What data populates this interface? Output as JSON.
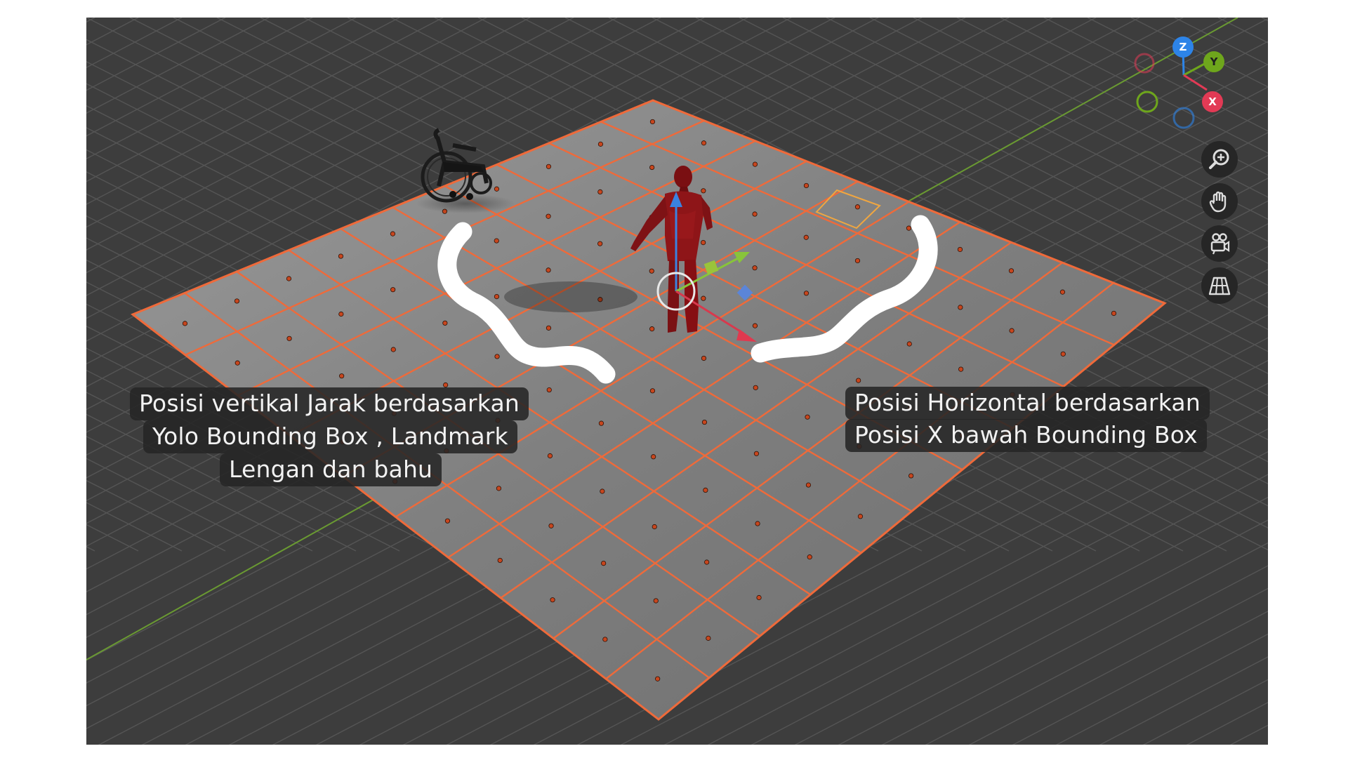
{
  "viewport": {
    "background": "#3d3d3d",
    "grid_color": "#555555",
    "x_axis_color": "#6a9a32",
    "floor_color": "#8e8e8e",
    "floor_edge_color": "#ef6a3a",
    "floor_divisions": 10,
    "objects": [
      "wheelchair",
      "human-figure",
      "transform-gizmo",
      "3d-cursor"
    ]
  },
  "axis_gizmo": {
    "z_label": "Z",
    "y_label": "Y",
    "x_label": "X",
    "z_color": "#2d84e8",
    "y_color": "#6ea61c",
    "x_color": "#e23a55"
  },
  "nav_tools": [
    {
      "icon": "zoom-in-icon"
    },
    {
      "icon": "hand-pan-icon"
    },
    {
      "icon": "camera-icon"
    },
    {
      "icon": "perspective-grid-icon"
    }
  ],
  "captions": {
    "left": {
      "line1": "Posisi vertikal Jarak berdasarkan",
      "line2": "Yolo Bounding Box , Landmark",
      "line3": "Lengan dan bahu"
    },
    "right": {
      "line1": "Posisi Horizontal berdasarkan",
      "line2": "Posisi X bawah Bounding Box"
    }
  }
}
